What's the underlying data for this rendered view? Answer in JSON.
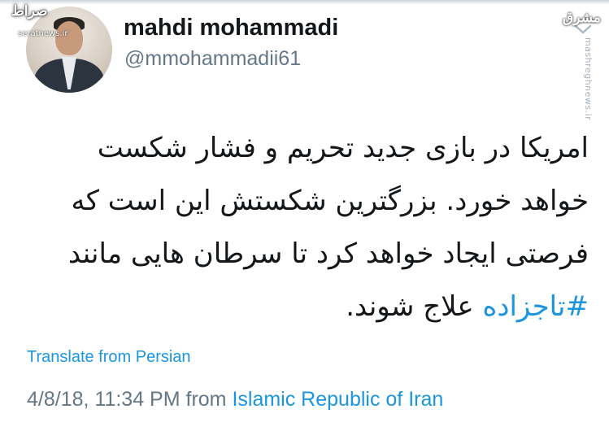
{
  "watermark": {
    "left_logo": "صراط",
    "left_site": "seratnews.ir",
    "right_logo": "مشرق",
    "right_site": "mashreghnews.ir"
  },
  "profile": {
    "display_name": "mahdi mohammadi",
    "handle": "@mmohammadii61",
    "avatar": "user-avatar-photo"
  },
  "menu": {
    "icon": "chevron-down-icon"
  },
  "tweet": {
    "text_before": "امریکا در بازی جدید تحریم و فشار شکست خواهد خورد. بزرگترین شکستش این است که فرصتی ایجاد خواهد کرد تا سرطان هایی مانند ",
    "hashtag": "#تاجزاده",
    "text_after": " علاج شوند.",
    "translate": "Translate from Persian",
    "timestamp": "4/8/18, 11:34 PM from ",
    "location": "Islamic Republic of Iran"
  },
  "colors": {
    "link": "#1b95e0",
    "text": "#14171a",
    "muted": "#657786"
  }
}
